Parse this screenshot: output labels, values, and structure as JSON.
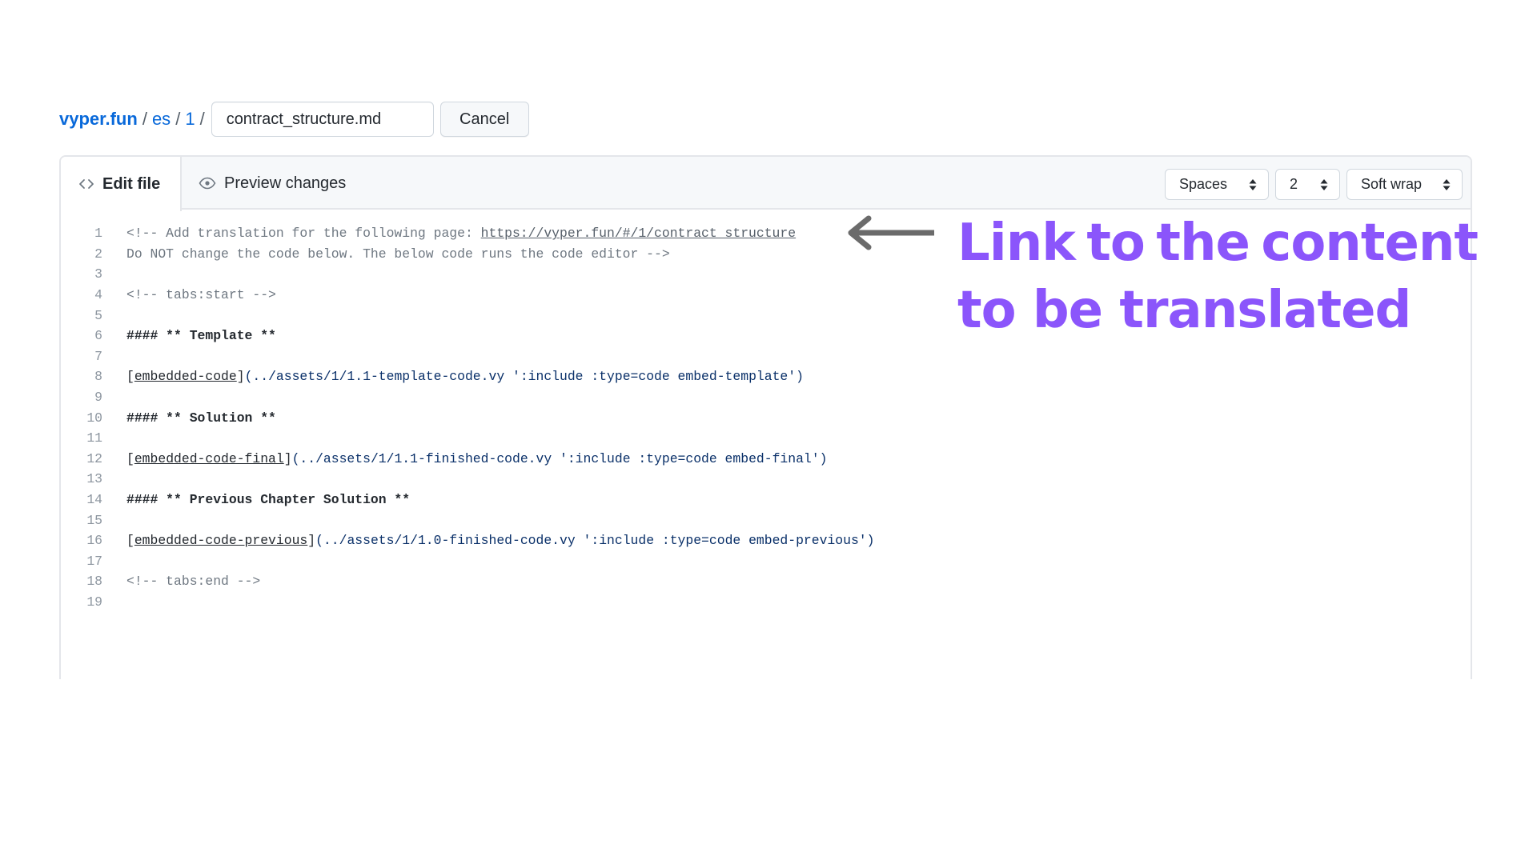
{
  "breadcrumb": {
    "root": "vyper.fun",
    "segments": [
      "es",
      "1"
    ],
    "separator": "/"
  },
  "filename_input": {
    "value": "contract_structure.md"
  },
  "cancel_button": {
    "label": "Cancel"
  },
  "editor": {
    "tabs": [
      {
        "label": "Edit file",
        "icon": "code-icon",
        "active": true
      },
      {
        "label": "Preview changes",
        "icon": "eye-icon",
        "active": false
      }
    ],
    "indent_mode": {
      "selected": "Spaces"
    },
    "indent_size": {
      "selected": "2"
    },
    "wrap_mode": {
      "selected": "Soft wrap"
    },
    "lines": [
      {
        "n": "1",
        "parts": [
          {
            "t": "<!-- Add translation for the following page: ",
            "k": "comment"
          },
          {
            "t": "https://vyper.fun/#/1/contract_structure",
            "k": "urlline"
          }
        ]
      },
      {
        "n": "2",
        "parts": [
          {
            "t": "Do NOT change the code below. The below code runs the code editor -->",
            "k": "comment"
          }
        ]
      },
      {
        "n": "3",
        "parts": []
      },
      {
        "n": "4",
        "parts": [
          {
            "t": "<!-- tabs:start -->",
            "k": "comment"
          }
        ]
      },
      {
        "n": "5",
        "parts": []
      },
      {
        "n": "6",
        "parts": [
          {
            "t": "#### ** Template **",
            "k": "heading"
          }
        ]
      },
      {
        "n": "7",
        "parts": []
      },
      {
        "n": "8",
        "parts": [
          {
            "t": "[",
            "k": "link"
          },
          {
            "t": "embedded-code",
            "k": "linktext"
          },
          {
            "t": "]",
            "k": "link"
          },
          {
            "t": "(../assets/1/1.1-template-code.vy ':include :type=code embed-template')",
            "k": "url"
          }
        ]
      },
      {
        "n": "9",
        "parts": []
      },
      {
        "n": "10",
        "parts": [
          {
            "t": "#### ** Solution **",
            "k": "heading"
          }
        ]
      },
      {
        "n": "11",
        "parts": []
      },
      {
        "n": "12",
        "parts": [
          {
            "t": "[",
            "k": "link"
          },
          {
            "t": "embedded-code-final",
            "k": "linktext"
          },
          {
            "t": "]",
            "k": "link"
          },
          {
            "t": "(../assets/1/1.1-finished-code.vy ':include :type=code embed-final')",
            "k": "url"
          }
        ]
      },
      {
        "n": "13",
        "parts": []
      },
      {
        "n": "14",
        "parts": [
          {
            "t": "#### ** Previous Chapter Solution **",
            "k": "heading"
          }
        ]
      },
      {
        "n": "15",
        "parts": []
      },
      {
        "n": "16",
        "parts": [
          {
            "t": "[",
            "k": "link"
          },
          {
            "t": "embedded-code-previous",
            "k": "linktext"
          },
          {
            "t": "]",
            "k": "link"
          },
          {
            "t": "(../assets/1/1.0-finished-code.vy ':include :type=code embed-previous')",
            "k": "url"
          }
        ]
      },
      {
        "n": "17",
        "parts": []
      },
      {
        "n": "18",
        "parts": [
          {
            "t": "<!-- tabs:end -->",
            "k": "comment"
          }
        ]
      },
      {
        "n": "19",
        "parts": []
      }
    ]
  },
  "annotation": {
    "line1_words": [
      "Link",
      "to",
      "the",
      "content"
    ],
    "line2": "to be translated",
    "color": "#8b55fb",
    "arrow_icon": "arrow-left-icon",
    "arrow_color": "#6b6b6b"
  },
  "colors": {
    "link_blue": "#0969da",
    "border": "#e4e6ea",
    "tabbar_bg": "#f6f8fa"
  }
}
